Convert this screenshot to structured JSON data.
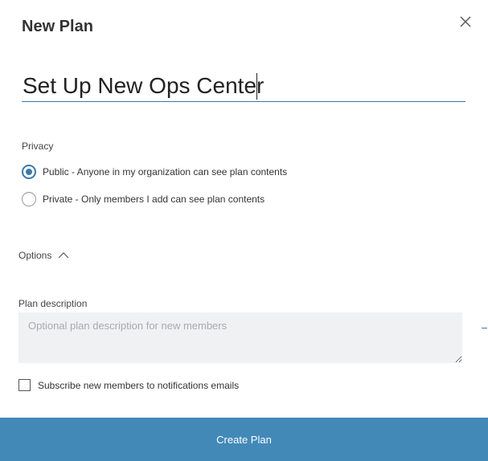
{
  "dialog": {
    "title": "New Plan",
    "close_icon": "close-icon"
  },
  "plan_name": {
    "value": "Set Up New Ops Center"
  },
  "privacy": {
    "label": "Privacy",
    "options": [
      {
        "label": "Public - Anyone in my organization can see plan contents",
        "selected": true
      },
      {
        "label": "Private - Only members I add can see plan contents",
        "selected": false
      }
    ]
  },
  "options": {
    "label": "Options",
    "icon": "chevron-up-icon",
    "expanded": true
  },
  "description": {
    "label": "Plan description",
    "placeholder": "Optional plan description for new members",
    "value": ""
  },
  "subscribe": {
    "label": "Subscribe new members to notifications emails",
    "checked": false
  },
  "create_button": {
    "label": "Create Plan"
  },
  "colors": {
    "accent": "#3c7aa6",
    "button_bg": "#4289b8",
    "field_bg": "#f0f1f2"
  }
}
